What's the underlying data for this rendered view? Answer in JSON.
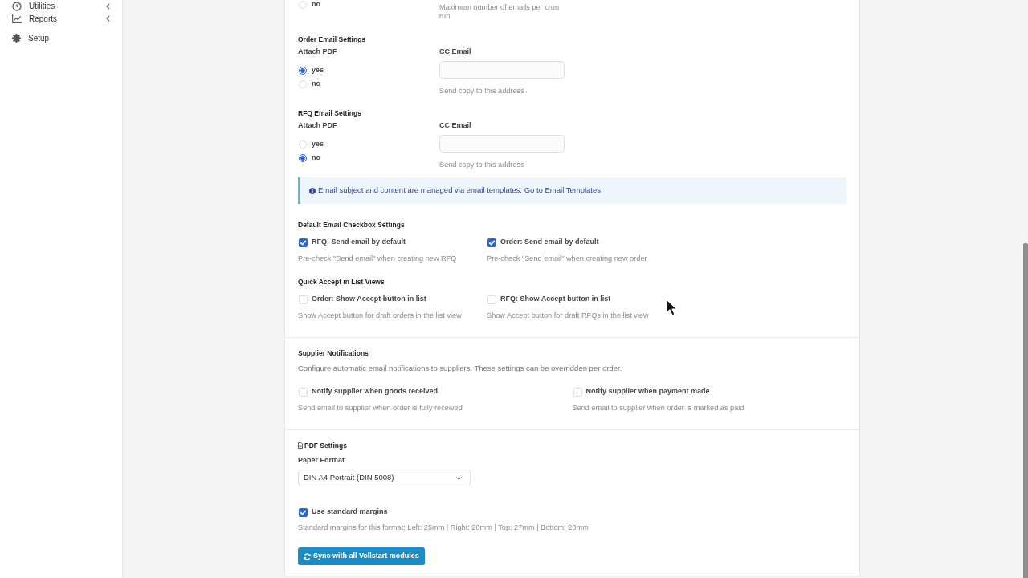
{
  "sidebar": {
    "items": [
      {
        "label": "Utilities",
        "submenu": true
      },
      {
        "label": "Reports",
        "submenu": true
      },
      {
        "label": "Setup",
        "submenu": false
      }
    ]
  },
  "top_fragment": {
    "radio": {
      "label": "no",
      "selected": false
    },
    "help": "Maximum number of emails per cron run"
  },
  "email_settings": [
    {
      "title": "Order Email Settings",
      "attach_label": "Attach PDF",
      "options": [
        {
          "label": "yes",
          "selected": true
        },
        {
          "label": "no",
          "selected": false
        }
      ],
      "cc_label": "CC Email",
      "cc_help": "Send copy to this address"
    },
    {
      "title": "RFQ Email Settings",
      "attach_label": "Attach PDF",
      "options": [
        {
          "label": "yes",
          "selected": false
        },
        {
          "label": "no",
          "selected": true
        }
      ],
      "cc_label": "CC Email",
      "cc_help": "Send copy to this address"
    }
  ],
  "alert": {
    "text": "Email subject and content are managed via email templates.",
    "link": "Go to Email Templates"
  },
  "checkbox_groups": [
    {
      "title": "Default Email Checkbox Settings",
      "items": [
        {
          "label": "RFQ: Send email by default",
          "help": "Pre-check \"Send email\" when creating new RFQ",
          "checked": true
        },
        {
          "label": "Order: Send email by default",
          "help": "Pre-check \"Send email\" when creating new order",
          "checked": true
        }
      ]
    },
    {
      "title": "Quick Accept in List Views",
      "items": [
        {
          "label": "Order: Show Accept button in list",
          "help": "Show Accept button for draft orders in the list view",
          "checked": false
        },
        {
          "label": "RFQ: Show Accept button in list",
          "help": "Show Accept button for draft RFQs in the list view",
          "checked": false
        }
      ]
    }
  ],
  "supplier_notifications": {
    "title": "Supplier Notifications",
    "description": "Configure automatic email notifications to suppliers. These settings can be overridden per order.",
    "items": [
      {
        "label": "Notify supplier when goods received",
        "help": "Send email to supplier when order is fully received",
        "checked": false
      },
      {
        "label": "Notify supplier when payment made",
        "help": "Send email to supplier when order is marked as paid",
        "checked": false
      }
    ]
  },
  "pdf_settings": {
    "title": "PDF Settings",
    "paper_format": {
      "label": "Paper Format",
      "value": "DIN A4 Portrait (DIN 5008)"
    },
    "margins": {
      "label": "Use standard margins",
      "checked": true,
      "help": "Standard margins for this format: Left: 25mm | Right: 20mm | Top: 27mm | Bottom: 20mm"
    },
    "sync_button": "Sync with all Vollstart modules"
  }
}
